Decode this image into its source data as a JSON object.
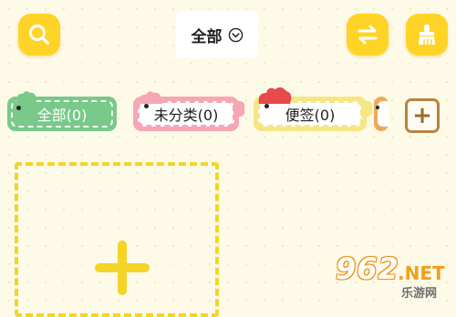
{
  "header": {
    "filter": {
      "label": "全部"
    }
  },
  "icons": {
    "search": "search-icon",
    "swap": "swap-icon",
    "brush": "brush-icon",
    "dropdown": "chevron-down-circle-icon",
    "add": "plus-icon"
  },
  "tags": [
    {
      "label": "全部(0)",
      "color": "#78c98a",
      "selected": true
    },
    {
      "label": "未分类(0)",
      "color": "#f6a6b4",
      "selected": false
    },
    {
      "label": "便签(0)",
      "color": "#f7e685",
      "selected": false
    }
  ],
  "add_tag": {
    "label": "+"
  },
  "watermark": {
    "number": "962",
    "domain": ".NET",
    "site_name": "乐游网"
  },
  "colors": {
    "background": "#fdfae8",
    "accent_yellow": "#ffd426",
    "card_dash": "#f4d426",
    "add_tag_border": "#b98340"
  }
}
